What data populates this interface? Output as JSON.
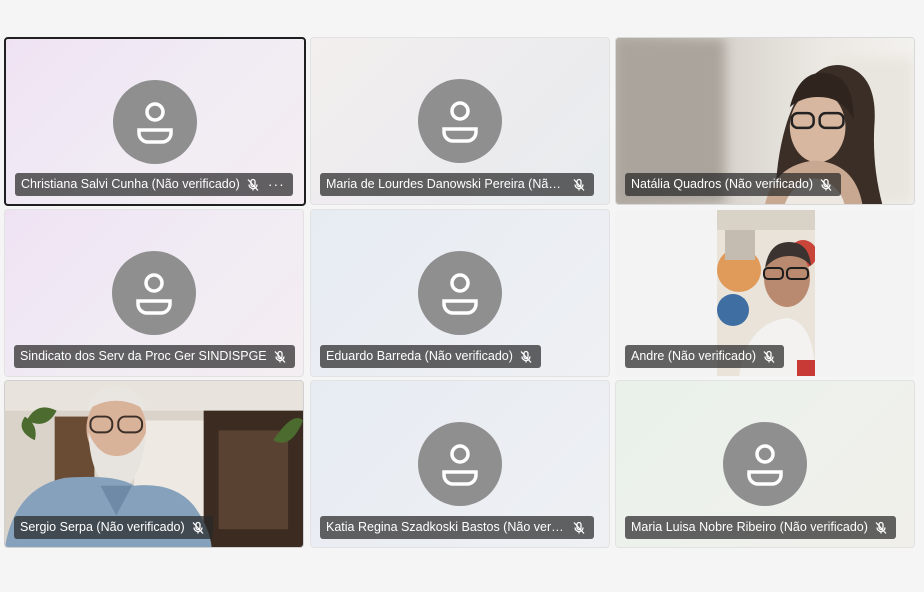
{
  "participants": [
    {
      "name": "Christiana Salvi Cunha (Não verificado)",
      "video": false,
      "muted": true,
      "active": true,
      "more": "···"
    },
    {
      "name": "Maria de Lourdes Danowski Pereira (Não verificado)",
      "video": false,
      "muted": true
    },
    {
      "name": "Natália Quadros (Não verificado)",
      "video": true,
      "muted": true
    },
    {
      "name": "Sindicato dos Serv da Proc Ger SINDISPGE",
      "video": false,
      "muted": true
    },
    {
      "name": "Eduardo Barreda (Não verificado)",
      "video": false,
      "muted": true
    },
    {
      "name": "Andre (Não verificado)",
      "video": true,
      "muted": true
    },
    {
      "name": "Sergio Serpa (Não verificado)",
      "video": true,
      "muted": true
    },
    {
      "name": "Katia Regina Szadkoski Bastos (Não verificado)",
      "video": false,
      "muted": true
    },
    {
      "name": "Maria Luisa Nobre Ribeiro (Não verificado)",
      "video": false,
      "muted": true
    }
  ],
  "icons": {
    "avatar": "person-icon",
    "mic": "mic-off-icon",
    "more": "more-options-icon"
  }
}
